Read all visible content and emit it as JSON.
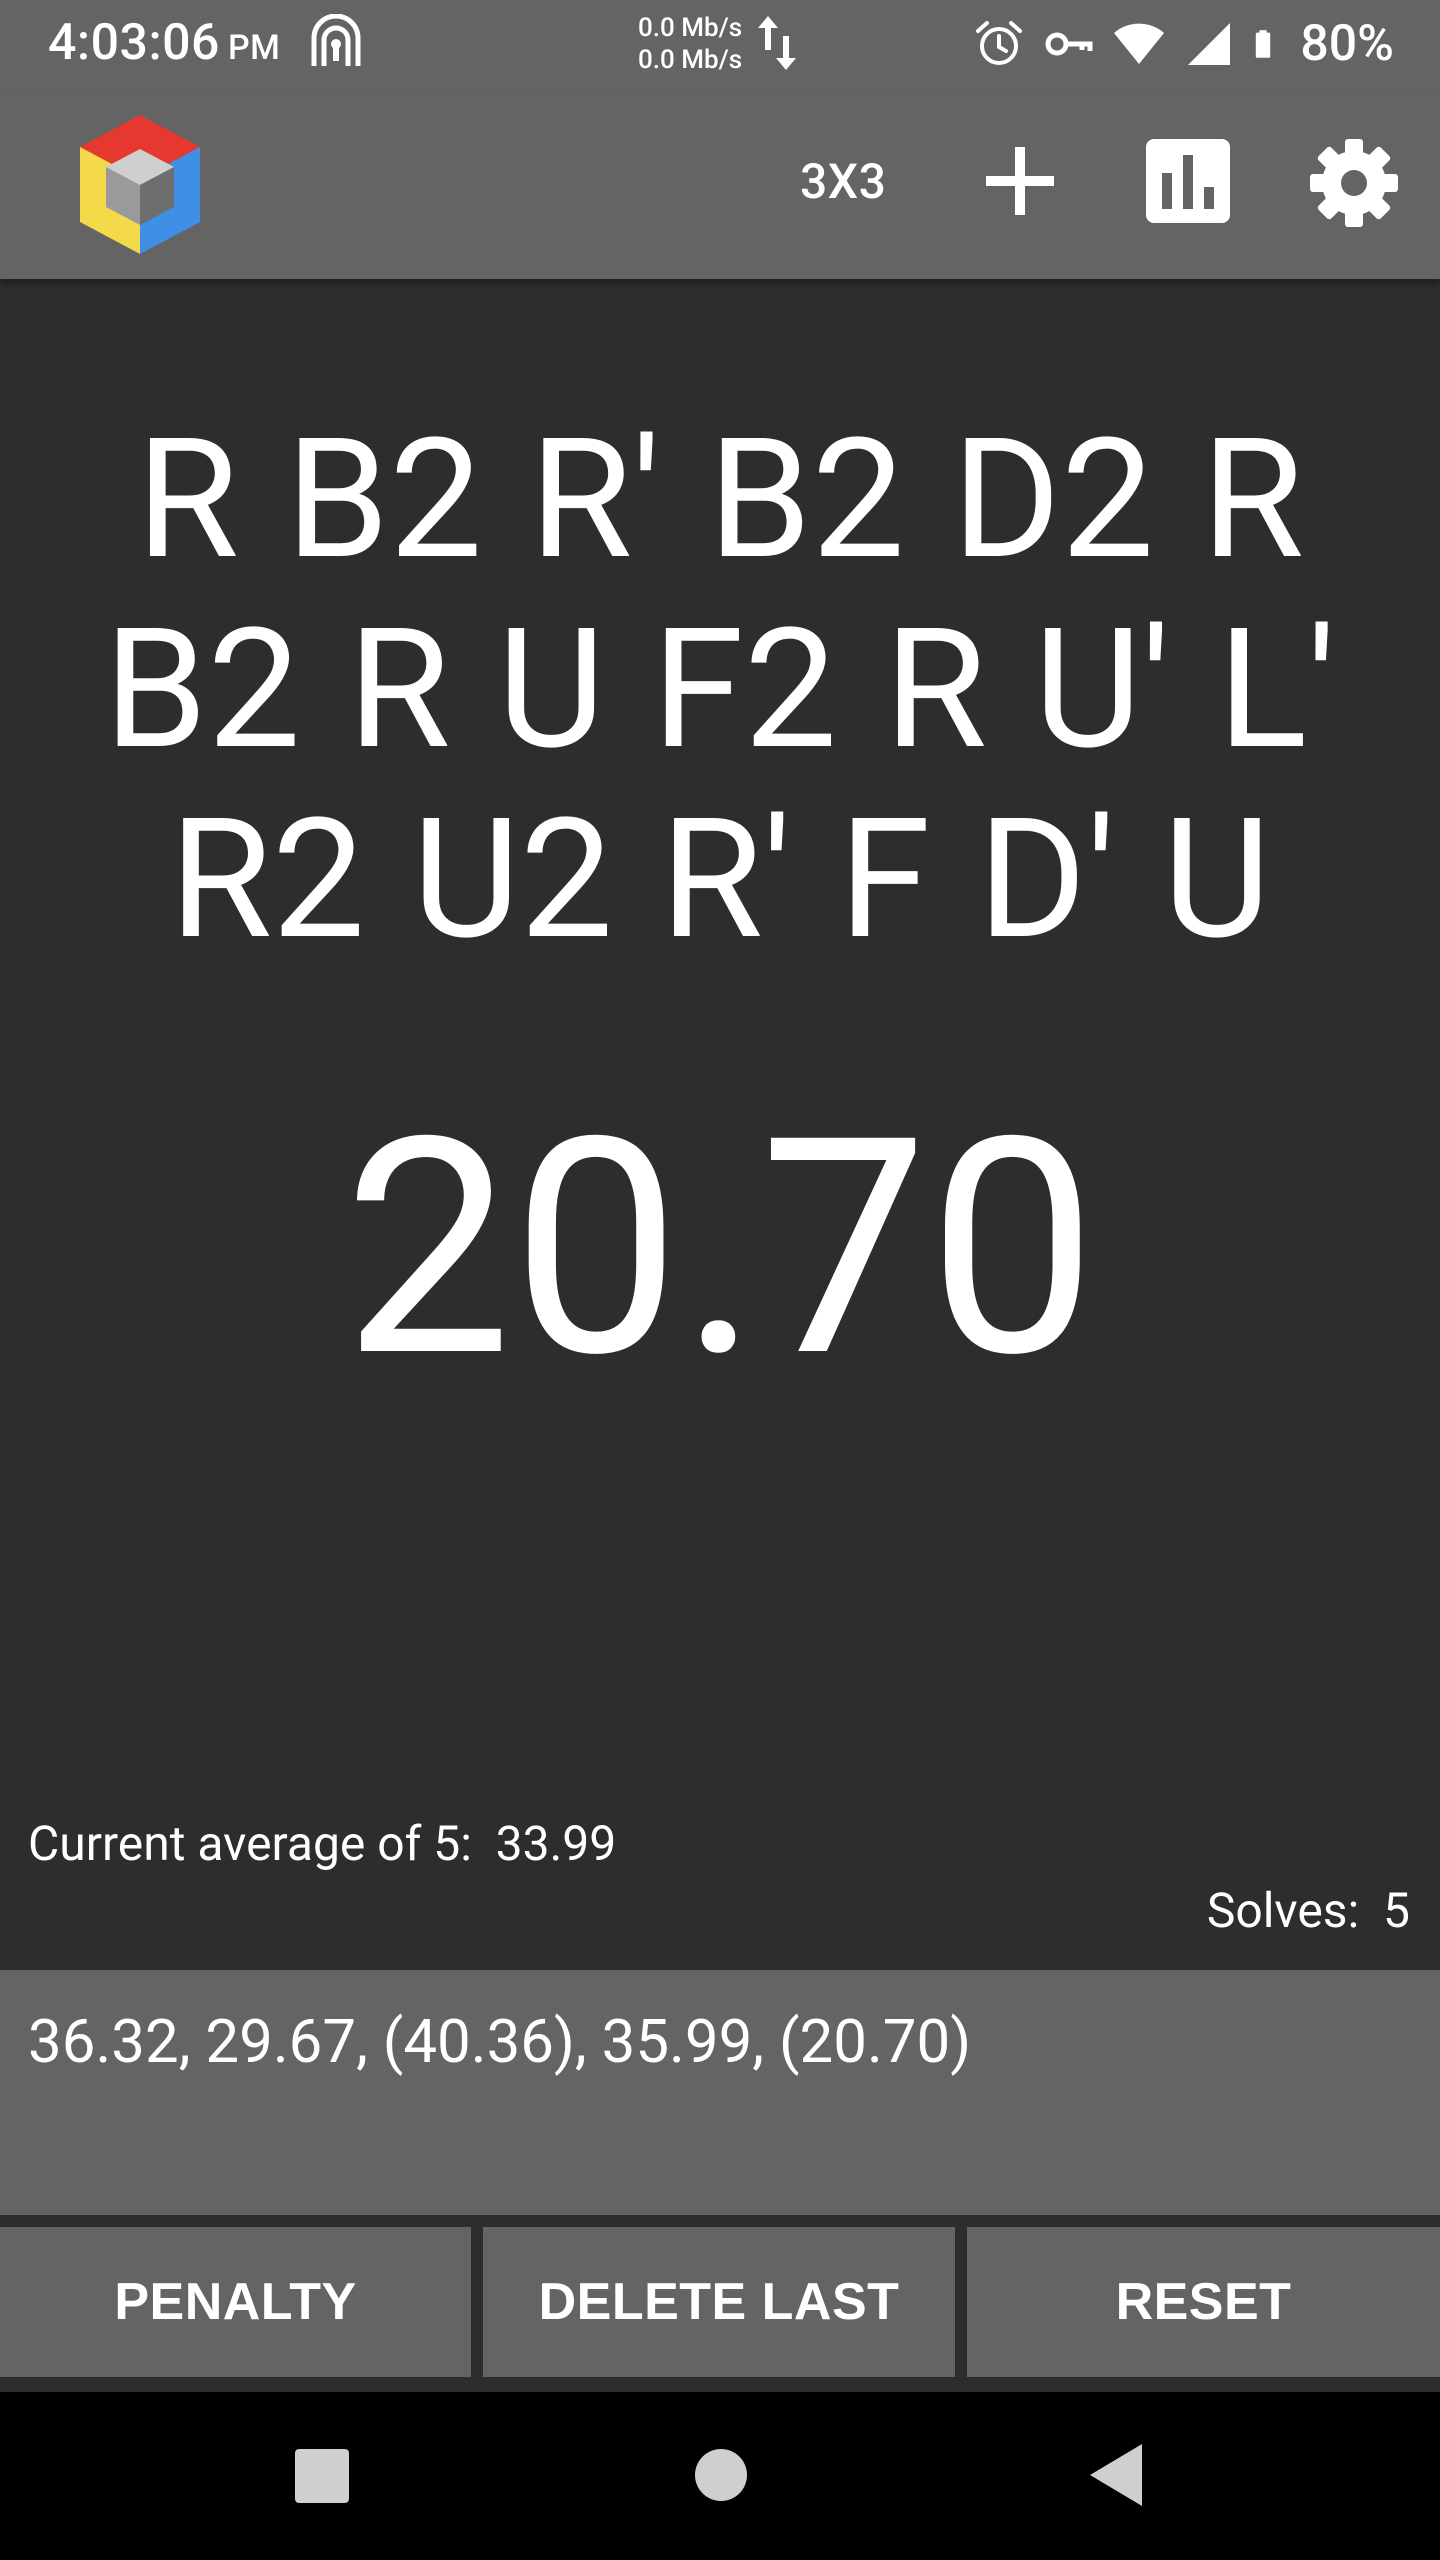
{
  "status_bar": {
    "time": "4:03:06",
    "ampm": "PM",
    "net_up": "0.0 Mb/s",
    "net_down": "0.0 Mb/s",
    "battery_pct": "80%",
    "icons": [
      "tor-icon",
      "data-transfer-icon",
      "alarm-icon",
      "vpn-key-icon",
      "wifi-icon",
      "cell-signal-icon",
      "battery-icon"
    ]
  },
  "app_bar": {
    "puzzle_type": "3X3",
    "icons": [
      "app-logo-cube",
      "add-icon",
      "bar-chart-icon",
      "settings-gear-icon"
    ]
  },
  "scramble": "R B2 R' B2 D2 R B2 R U F2 R U' L' R2 U2 R' F D' U",
  "timer": "20.70",
  "stats": {
    "average_label": "Current average of 5:",
    "average_value": "33.99",
    "solves_label": "Solves:",
    "solves_value": "5"
  },
  "times_list": "36.32, 29.67, (40.36), 35.99, (20.70)",
  "buttons": {
    "penalty": "PENALTY",
    "delete_last": "DELETE LAST",
    "reset": "RESET"
  },
  "nav": {
    "icons": [
      "recent-apps-icon",
      "home-icon",
      "back-icon"
    ]
  },
  "colors": {
    "bar_gray": "#646464",
    "background": "#2d2d2d",
    "nav_black": "#000000"
  }
}
